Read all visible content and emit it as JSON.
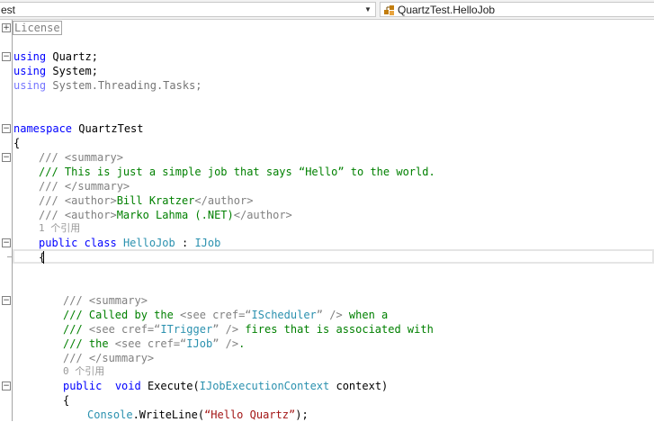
{
  "nav": {
    "project_dropdown": "est",
    "member_dropdown": "QuartzTest.HelloJob",
    "class_icon": "class-icon"
  },
  "colors": {
    "keyword": "#0000ff",
    "type": "#2b91af",
    "comment": "#008000",
    "doc_tag": "#808080",
    "string": "#a31515",
    "codelens": "#999999"
  },
  "code": {
    "region": "License",
    "using1_kw": "using",
    "using1_ns": " Quartz;",
    "using2_kw": "using",
    "using2_ns": " System;",
    "using3_kw": "using",
    "using3_ns": " System.Threading.Tasks;",
    "ns_kw": "namespace",
    "ns_name": " QuartzTest",
    "brace_open": "{",
    "doc1_prefix": "/// ",
    "doc1_tag": "<summary>",
    "doc2": "/// This is just a simple job that says “Hello” to the world.",
    "doc3_prefix": "/// ",
    "doc3_tag": "</summary>",
    "doc4_prefix": "/// ",
    "doc4_tag_open": "<author>",
    "doc4_text": "Bill Kratzer",
    "doc4_tag_close": "</author>",
    "doc5_prefix": "/// ",
    "doc5_tag_open": "<author>",
    "doc5_text": "Marko Lahma (.NET)",
    "doc5_tag_close": "</author>",
    "lens1": "1 个引用",
    "class_kw1": "public",
    "class_kw2": "class",
    "class_name": "HelloJob",
    "class_colon": " : ",
    "class_iface": "IJob",
    "class_brace": "{",
    "mdoc1_prefix": "/// ",
    "mdoc1_tag": "<summary>",
    "mdoc2_a": "/// Called by the ",
    "mdoc2_tag1": "<see cref=“",
    "mdoc2_cref": "IScheduler",
    "mdoc2_tag2": "” />",
    "mdoc2_b": " when a",
    "mdoc3_a": "/// ",
    "mdoc3_tag1": "<see cref=“",
    "mdoc3_cref": "ITrigger",
    "mdoc3_tag2": "” />",
    "mdoc3_b": " fires that is associated with",
    "mdoc4_a": "/// the ",
    "mdoc4_tag1": "<see cref=“",
    "mdoc4_cref": "IJob",
    "mdoc4_tag2": "” />",
    "mdoc4_b": ".",
    "mdoc5_prefix": "/// ",
    "mdoc5_tag": "</summary>",
    "lens2": "0 个引用",
    "m_kw1": "public",
    "m_kw2": "void",
    "m_name": " Execute(",
    "m_ptype": "IJobExecutionContext",
    "m_pname": " context)",
    "m_brace": "{",
    "body_type": "Console",
    "body_call": ".WriteLine(",
    "body_str": "“Hello Quartz”",
    "body_end": ");"
  }
}
